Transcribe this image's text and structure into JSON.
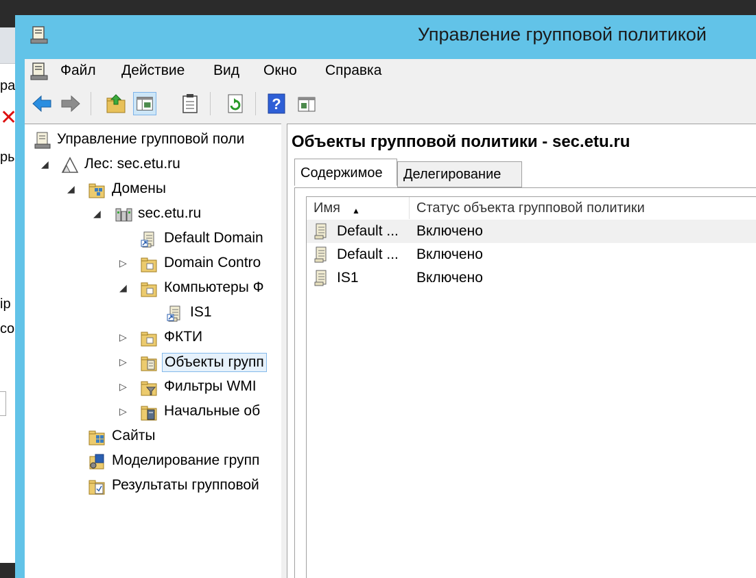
{
  "background_window": {
    "fragments": [
      "ра",
      "ры",
      "ip",
      "co"
    ]
  },
  "window": {
    "title": "Управление групповой политикой"
  },
  "menu": [
    "Файл",
    "Действие",
    "Вид",
    "Окно",
    "Справка"
  ],
  "toolbar": {
    "buttons": [
      "back-arrow-icon",
      "forward-arrow-icon",
      "up-folder-icon",
      "show-hide-tree-icon",
      "clipboard-icon",
      "refresh-icon",
      "help-icon",
      "show-hide-action-pane-icon"
    ]
  },
  "tree": {
    "items": [
      {
        "label": "Управление групповой поли",
        "icon": "gpmc-icon",
        "expander": ""
      },
      {
        "label": "Лес: sec.etu.ru",
        "icon": "forest-icon",
        "expander": "◢"
      },
      {
        "label": "Домены",
        "icon": "domains-folder-icon",
        "expander": "◢"
      },
      {
        "label": "sec.etu.ru",
        "icon": "domain-icon",
        "expander": "◢"
      },
      {
        "label": "Default Domain",
        "icon": "gpo-link-icon",
        "expander": ""
      },
      {
        "label": "Domain Contro",
        "icon": "ou-folder-icon",
        "expander": "▷"
      },
      {
        "label": "Компьютеры Ф",
        "icon": "ou-folder-icon",
        "expander": "◢"
      },
      {
        "label": "IS1",
        "icon": "gpo-link-icon",
        "expander": ""
      },
      {
        "label": "ФКТИ",
        "icon": "ou-folder-icon",
        "expander": "▷"
      },
      {
        "label": "Объекты групп",
        "icon": "gpo-folder-icon",
        "expander": "▷"
      },
      {
        "label": "Фильтры WMI",
        "icon": "wmi-filter-folder-icon",
        "expander": "▷"
      },
      {
        "label": "Начальные об",
        "icon": "starter-gpo-folder-icon",
        "expander": "▷"
      },
      {
        "label": "Сайты",
        "icon": "sites-icon",
        "expander": ""
      },
      {
        "label": "Моделирование групп",
        "icon": "modeling-icon",
        "expander": ""
      },
      {
        "label": "Результаты групповой",
        "icon": "results-icon",
        "expander": ""
      }
    ]
  },
  "details": {
    "title": "Объекты групповой политики - sec.etu.ru",
    "tabs": [
      "Содержимое",
      "Делегирование"
    ],
    "columns": [
      "Имя",
      "Статус объекта групповой политики"
    ],
    "rows": [
      {
        "name": "Default ...",
        "status": "Включено"
      },
      {
        "name": "Default ...",
        "status": "Включено"
      },
      {
        "name": "IS1",
        "status": "Включено"
      }
    ]
  },
  "colors": {
    "titlebar": "#62c3e8",
    "selection_border": "#84b9ea",
    "selection_fill": "#e6f1fb"
  }
}
